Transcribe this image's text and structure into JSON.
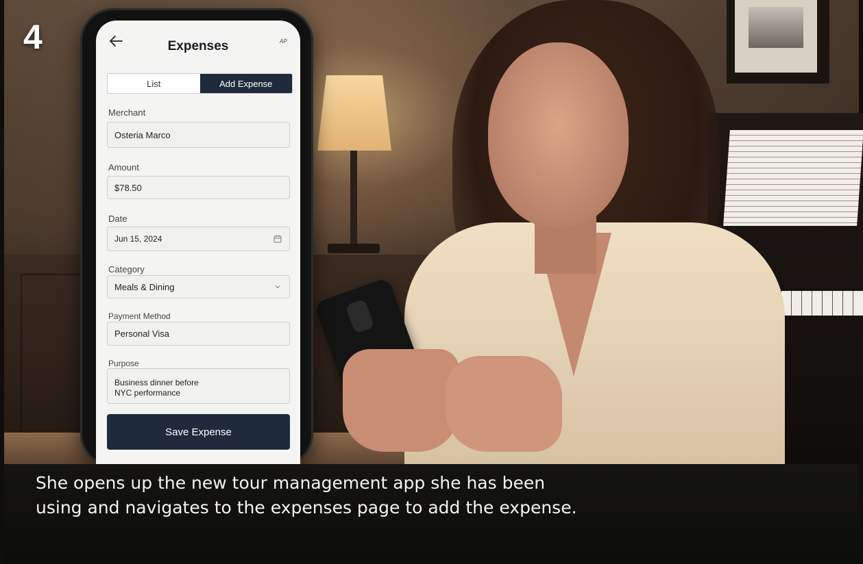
{
  "step": {
    "number": "4"
  },
  "app": {
    "header": {
      "back_icon": "arrow-left-icon",
      "title": "Expenses",
      "mini_label": "AP"
    },
    "tabs": [
      {
        "label": "List",
        "active": false
      },
      {
        "label": "Add Expense",
        "active": true
      }
    ],
    "form": {
      "merchant": {
        "label": "Merchant",
        "value": "Osteria Marco"
      },
      "amount": {
        "label": "Amount",
        "value": "$78.50"
      },
      "date": {
        "label": "Date",
        "value": "Jun 15, 2024",
        "icon": "calendar-icon"
      },
      "category": {
        "label": "Category",
        "value": "Meals & Dining",
        "icon": "chevron-down-icon"
      },
      "payment_method": {
        "label": "Payment Method",
        "value": "Personal Visa"
      },
      "purpose": {
        "label": "Purpose",
        "value": "Business dinner before\nNYC performance"
      }
    },
    "save_button": "Save Expense",
    "accent_color": "#1f2a3d"
  },
  "caption": "She opens up the new tour management app she has been using and navigates to the expenses page to add the expense."
}
